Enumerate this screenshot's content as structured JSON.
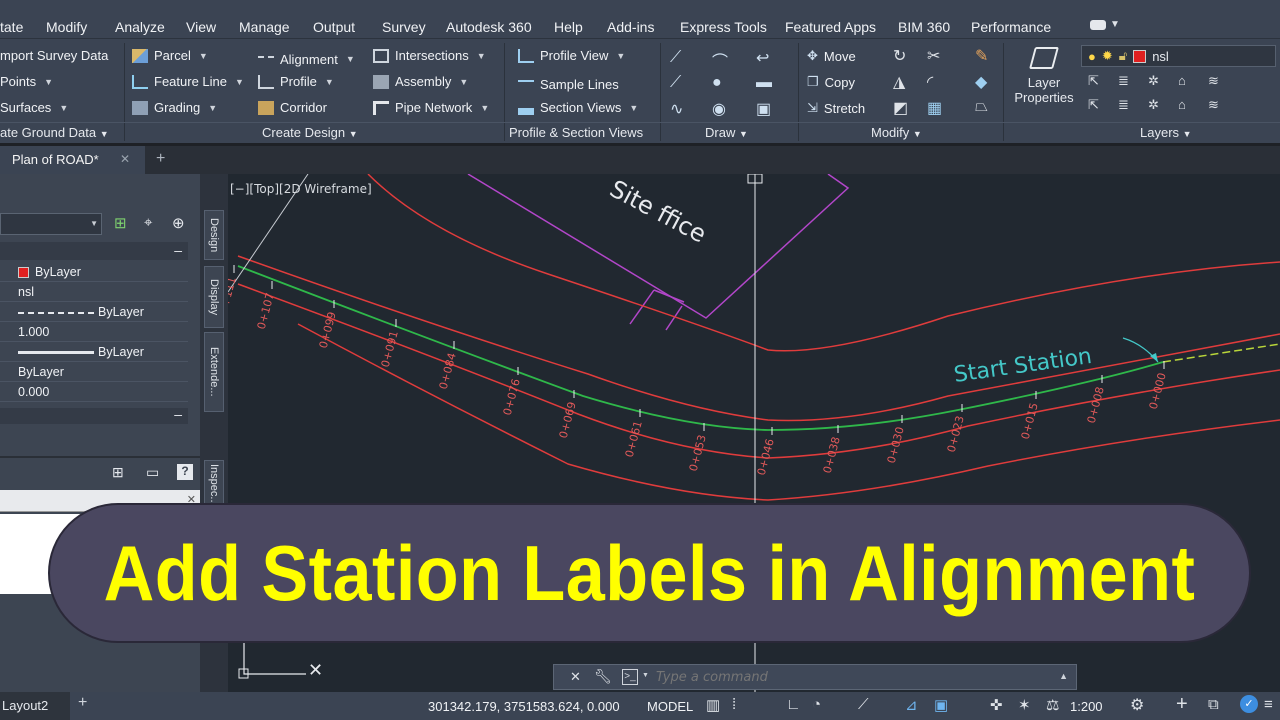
{
  "menu": {
    "items": [
      "tate",
      "Modify",
      "Analyze",
      "View",
      "Manage",
      "Output",
      "Survey",
      "Autodesk 360",
      "Help",
      "Add-ins",
      "Express Tools",
      "Featured Apps",
      "BIM 360",
      "Performance"
    ]
  },
  "ribbon": {
    "ground": {
      "import_survey": "mport Survey Data",
      "points": "Points",
      "surfaces": "Surfaces",
      "title": "ate Ground Data"
    },
    "design": {
      "parcel": "Parcel",
      "feature_line": "Feature Line",
      "grading": "Grading",
      "alignment": "Alignment",
      "profile": "Profile",
      "corridor": "Corridor",
      "intersections": "Intersections",
      "assembly": "Assembly",
      "pipe_network": "Pipe Network",
      "title": "Create Design"
    },
    "profile_views": {
      "profile_view": "Profile View",
      "sample_lines": "Sample Lines",
      "section_views": "Section Views",
      "title": "Profile & Section Views"
    },
    "draw": {
      "title": "Draw"
    },
    "modify": {
      "move": "Move",
      "copy": "Copy",
      "stretch": "Stretch",
      "title": "Modify"
    },
    "layers": {
      "layer_properties_1": "Layer",
      "layer_properties_2": "Properties",
      "current_layer": "nsl",
      "title": "Layers"
    }
  },
  "tabs": {
    "drawing": "Plan of ROAD*"
  },
  "properties": {
    "color": "ByLayer",
    "layer": "nsl",
    "linetype": "ByLayer",
    "linetype_scale": "1.000",
    "lineweight": "ByLayer",
    "transparency": "ByLayer",
    "thickness": "0.000"
  },
  "palette_tabs": {
    "design": "Design",
    "display": "Display",
    "extended": "Extende...",
    "inspect": "Inspec..."
  },
  "viewport": {
    "label": "[−][Top][2D Wireframe]",
    "site_office": "Site  ffice",
    "start_station": "Start Station",
    "stations": [
      "0+111",
      "0+107",
      "0+099",
      "0+091",
      "0+084",
      "0+076",
      "0+069",
      "0+061",
      "0+053",
      "0+046",
      "0+038",
      "0+030",
      "0+023",
      "0+015",
      "0+008",
      "0+000"
    ]
  },
  "command": {
    "placeholder": "Type a command"
  },
  "status": {
    "layout": "Layout2",
    "coords": "301342.179, 3751583.624, 0.000",
    "model": "MODEL",
    "scale": "1:200"
  },
  "banner": {
    "text": "Add Station Labels in Alignment"
  },
  "colors": {
    "road": "#e03c3c",
    "alignment": "#2fb84a",
    "site": "#b246c9",
    "station_label": "#e25a5a",
    "annotation": "#44c8c8",
    "banner_text": "#ffff00"
  }
}
